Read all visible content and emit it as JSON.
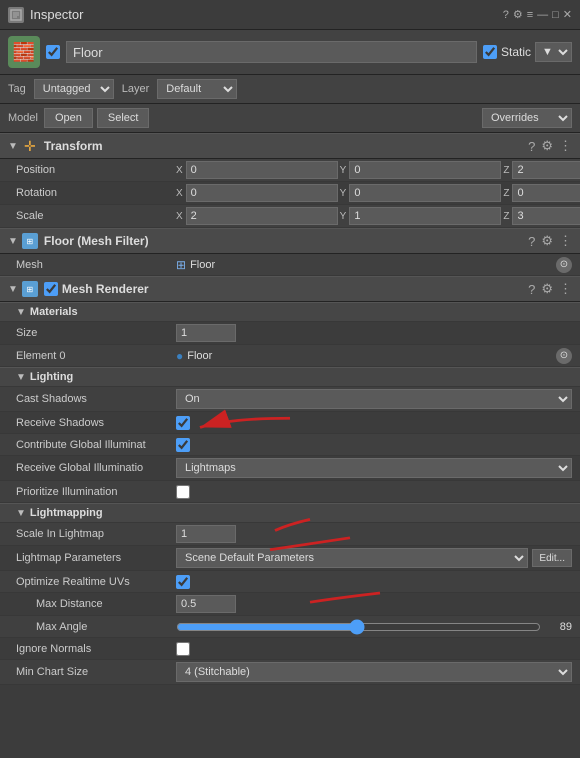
{
  "window": {
    "title": "Inspector",
    "controls": [
      "□",
      "?",
      "≡"
    ]
  },
  "object": {
    "name": "Floor",
    "enabled": true,
    "static_label": "Static",
    "tag_label": "Tag",
    "tag_value": "Untagged",
    "layer_label": "Layer",
    "layer_value": "Default"
  },
  "model_row": {
    "label": "Model",
    "open": "Open",
    "select": "Select",
    "overrides": "Overrides"
  },
  "transform": {
    "title": "Transform",
    "position_label": "Position",
    "position_x": "0",
    "position_y": "0",
    "position_z": "2",
    "rotation_label": "Rotation",
    "rotation_x": "0",
    "rotation_y": "0",
    "rotation_z": "0",
    "scale_label": "Scale",
    "scale_x": "2",
    "scale_y": "1",
    "scale_z": "3"
  },
  "mesh_filter": {
    "title": "Floor (Mesh Filter)",
    "mesh_label": "Mesh",
    "mesh_value": "Floor"
  },
  "mesh_renderer": {
    "title": "Mesh Renderer",
    "enabled": true,
    "materials_title": "Materials",
    "size_label": "Size",
    "size_value": "1",
    "element0_label": "Element 0",
    "element0_value": "Floor",
    "lighting_title": "Lighting",
    "cast_shadows_label": "Cast Shadows",
    "cast_shadows_value": "On",
    "receive_shadows_label": "Receive Shadows",
    "receive_shadows_checked": true,
    "contribute_gi_label": "Contribute Global Illuminat",
    "contribute_gi_checked": true,
    "receive_gi_label": "Receive Global Illuminatio",
    "receive_gi_value": "Lightmaps",
    "prioritize_label": "Prioritize Illumination",
    "prioritize_checked": false,
    "lightmapping_title": "Lightmapping",
    "scale_lightmap_label": "Scale In Lightmap",
    "scale_lightmap_value": "1",
    "lightmap_params_label": "Lightmap Parameters",
    "lightmap_params_value": "Scene Default Parameters",
    "edit_btn": "Edit...",
    "optimize_uvs_label": "Optimize Realtime UVs",
    "optimize_uvs_checked": true,
    "max_distance_label": "Max Distance",
    "max_distance_value": "0.5",
    "max_angle_label": "Max Angle",
    "max_angle_value": "89",
    "max_angle_slider": 89,
    "ignore_normals_label": "Ignore Normals",
    "ignore_normals_checked": false,
    "min_chart_label": "Min Chart Size",
    "min_chart_value": "4 (Stitchable)"
  }
}
